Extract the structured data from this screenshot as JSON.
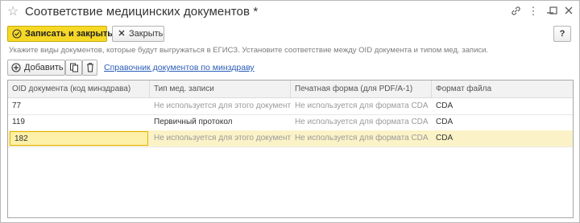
{
  "window": {
    "title": "Соответствие медицинских документов *",
    "controls": [
      "link-icon",
      "more-icon",
      "minimize-icon",
      "maximize-icon",
      "close-icon"
    ]
  },
  "toolbar": {
    "save_close_label": "Записать и закрыть",
    "close_label": "Закрыть",
    "help_label": "?"
  },
  "hint": "Укажите виды документов, которые будут выгружаться в ЕГИСЗ. Установите соответствие между OID документа и типом мед. записи.",
  "subtoolbar": {
    "add_label": "Добавить",
    "link_label": "Справочник документов по минздраву"
  },
  "table": {
    "columns": [
      "OID документа (код минздрава)",
      "Тип мед. записи",
      "Печатная форма (для PDF/A-1)",
      "Формат файла"
    ],
    "rows": [
      {
        "oid": "77",
        "type": "Не используется для этого документа",
        "print": "Не используется для формата CDA",
        "format": "CDA",
        "type_gray": true
      },
      {
        "oid": "119",
        "type": "Первичный протокол",
        "print": "Не используется для формата CDA",
        "format": "CDA",
        "type_gray": false
      },
      {
        "oid": "182",
        "type": "Не используется для этого документа",
        "print": "Не используется для формата CDA",
        "format": "CDA",
        "type_gray": true
      }
    ]
  },
  "colors": {
    "primary_button": "#f6d827",
    "selected_row": "#fbf3c7",
    "link": "#2b5db8"
  }
}
